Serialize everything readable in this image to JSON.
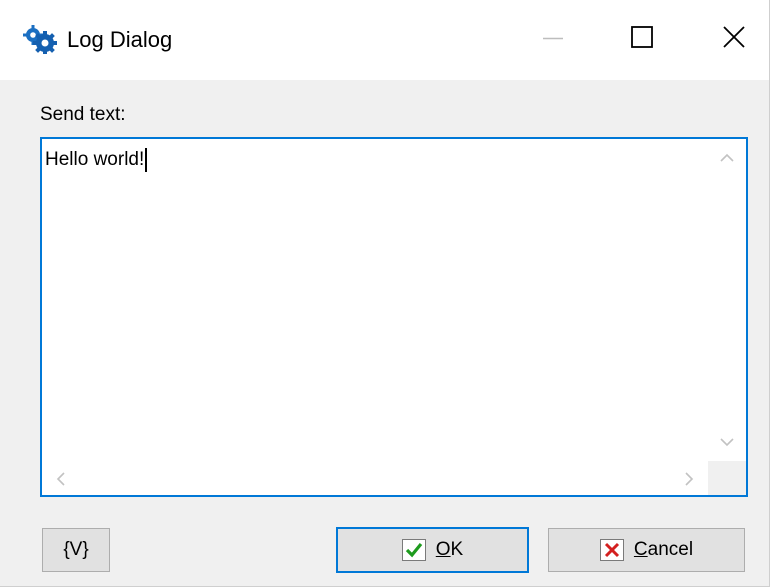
{
  "window": {
    "title": "Log Dialog",
    "icon": "gears-icon",
    "controls": {
      "minimize": "minimize-icon",
      "maximize": "maximize-icon",
      "close": "close-icon"
    }
  },
  "form": {
    "send_label": "Send text:",
    "send_value": "Hello world!"
  },
  "buttons": {
    "variables_label": "{V}",
    "ok_label": "OK",
    "ok_icon": "checkmark-icon",
    "cancel_label": "Cancel",
    "cancel_icon": "x-mark-icon"
  },
  "colors": {
    "focus_accent": "#0078d7",
    "ok_check": "#1e9b1e",
    "cancel_x": "#d42020",
    "icon_blue": "#1b6fc2"
  }
}
